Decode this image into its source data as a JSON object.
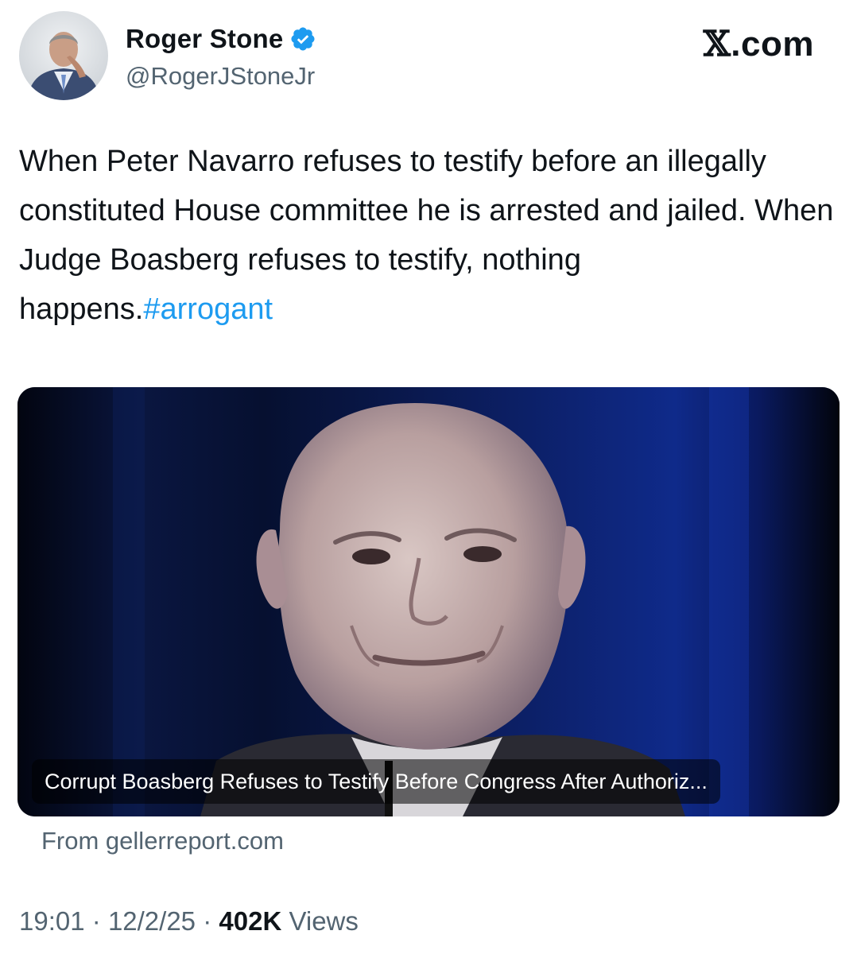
{
  "author": {
    "display_name": "Roger Stone",
    "handle": "@RogerJStoneJr",
    "verified": true,
    "verified_color": "#1d9bf0",
    "avatar_icon": "profile-photo"
  },
  "brand": {
    "logo_icon": "x-logo",
    "logo_glyph": "𝕏",
    "suffix": ".com"
  },
  "tweet": {
    "text": "When Peter Navarro refuses to testify before an illegally constituted House committee he is arrested and jailed. When Judge Boasberg refuses to testify, nothing happens.",
    "hashtag": "#arrogant",
    "hashtag_color": "#1d9bf0"
  },
  "link_card": {
    "image_icon": "article-photo",
    "caption": "Corrupt Boasberg Refuses to Testify Before Congress After Authoriz...",
    "source": "From gellerreport.com"
  },
  "meta": {
    "time": "19:01",
    "separator": "·",
    "date": "12/2/25",
    "views_count": "402K",
    "views_label": "Views"
  },
  "colors": {
    "text_primary": "#0f1419",
    "text_secondary": "#536471",
    "link": "#1d9bf0"
  }
}
